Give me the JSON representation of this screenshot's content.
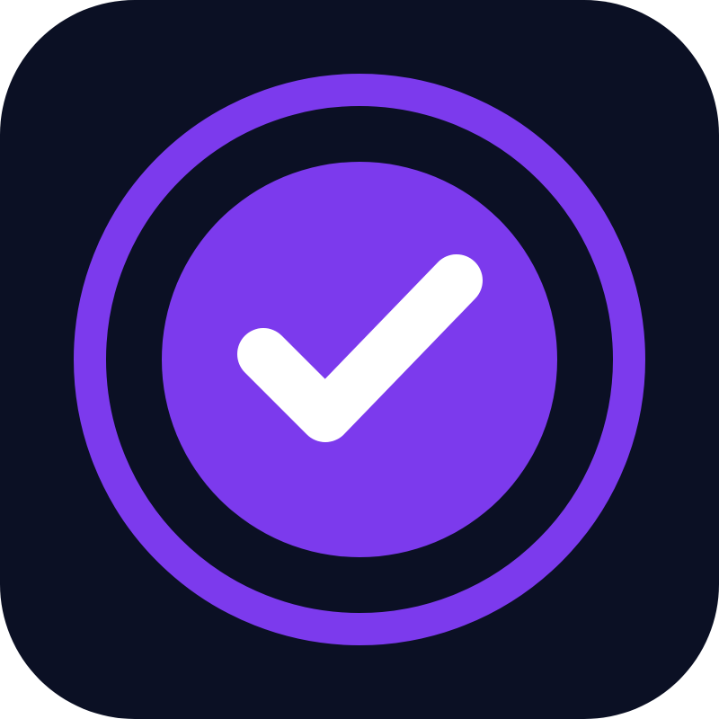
{
  "app_icon": {
    "icon": "checkmark-badge-icon",
    "colors": {
      "background": "#0b1024",
      "accent": "#7c3aed",
      "check": "#ffffff"
    }
  }
}
